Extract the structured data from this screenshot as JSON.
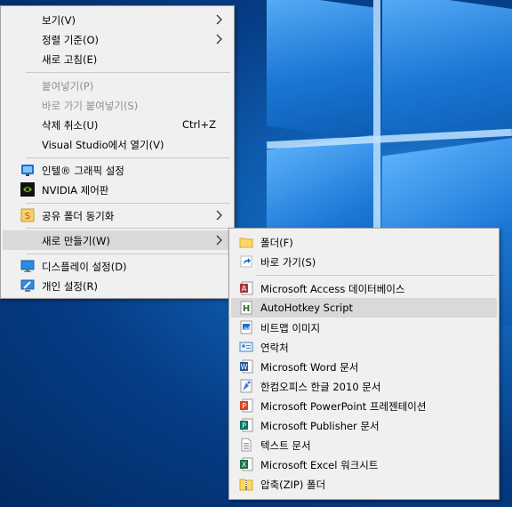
{
  "context_menu": {
    "items": [
      {
        "label": "보기(V)"
      },
      {
        "label": "정렬 기준(O)"
      },
      {
        "label": "새로 고침(E)"
      },
      {
        "label": "붙여넣기(P)"
      },
      {
        "label": "바로 가기 붙여넣기(S)"
      },
      {
        "label": "삭제 취소(U)",
        "shortcut": "Ctrl+Z"
      },
      {
        "label": "Visual Studio에서 열기(V)"
      },
      {
        "label": "인텔® 그래픽 설정",
        "icon": "intel-graphics-icon"
      },
      {
        "label": "NVIDIA 제어판",
        "icon": "nvidia-icon"
      },
      {
        "label": "공유 폴더 동기화",
        "icon": "shared-folder-sync-icon"
      },
      {
        "label": "새로 만들기(W)"
      },
      {
        "label": "디스플레이 설정(D)",
        "icon": "display-icon"
      },
      {
        "label": "개인 설정(R)",
        "icon": "personalize-icon"
      }
    ]
  },
  "new_submenu": {
    "items": [
      {
        "label": "폴더(F)",
        "icon": "folder-icon"
      },
      {
        "label": "바로 가기(S)",
        "icon": "shortcut-icon"
      },
      {
        "label": "Microsoft Access 데이터베이스",
        "icon": "access-icon"
      },
      {
        "label": "AutoHotkey Script",
        "icon": "autohotkey-icon"
      },
      {
        "label": "비트맵 이미지",
        "icon": "bitmap-icon"
      },
      {
        "label": "연락처",
        "icon": "contact-icon"
      },
      {
        "label": "Microsoft Word 문서",
        "icon": "word-icon"
      },
      {
        "label": "한컴오피스 한글 2010 문서",
        "icon": "hwp-icon"
      },
      {
        "label": "Microsoft PowerPoint 프레젠테이션",
        "icon": "powerpoint-icon"
      },
      {
        "label": "Microsoft Publisher 문서",
        "icon": "publisher-icon"
      },
      {
        "label": "텍스트 문서",
        "icon": "text-document-icon"
      },
      {
        "label": "Microsoft Excel 워크시트",
        "icon": "excel-icon"
      },
      {
        "label": "압축(ZIP) 폴더",
        "icon": "zip-folder-icon"
      }
    ]
  },
  "colors": {
    "menu_bg": "#f0f0f0",
    "highlight": "#d9d9d9",
    "disabled_text": "#8e8e8e",
    "desktop_blue": "#0f5fb3"
  }
}
